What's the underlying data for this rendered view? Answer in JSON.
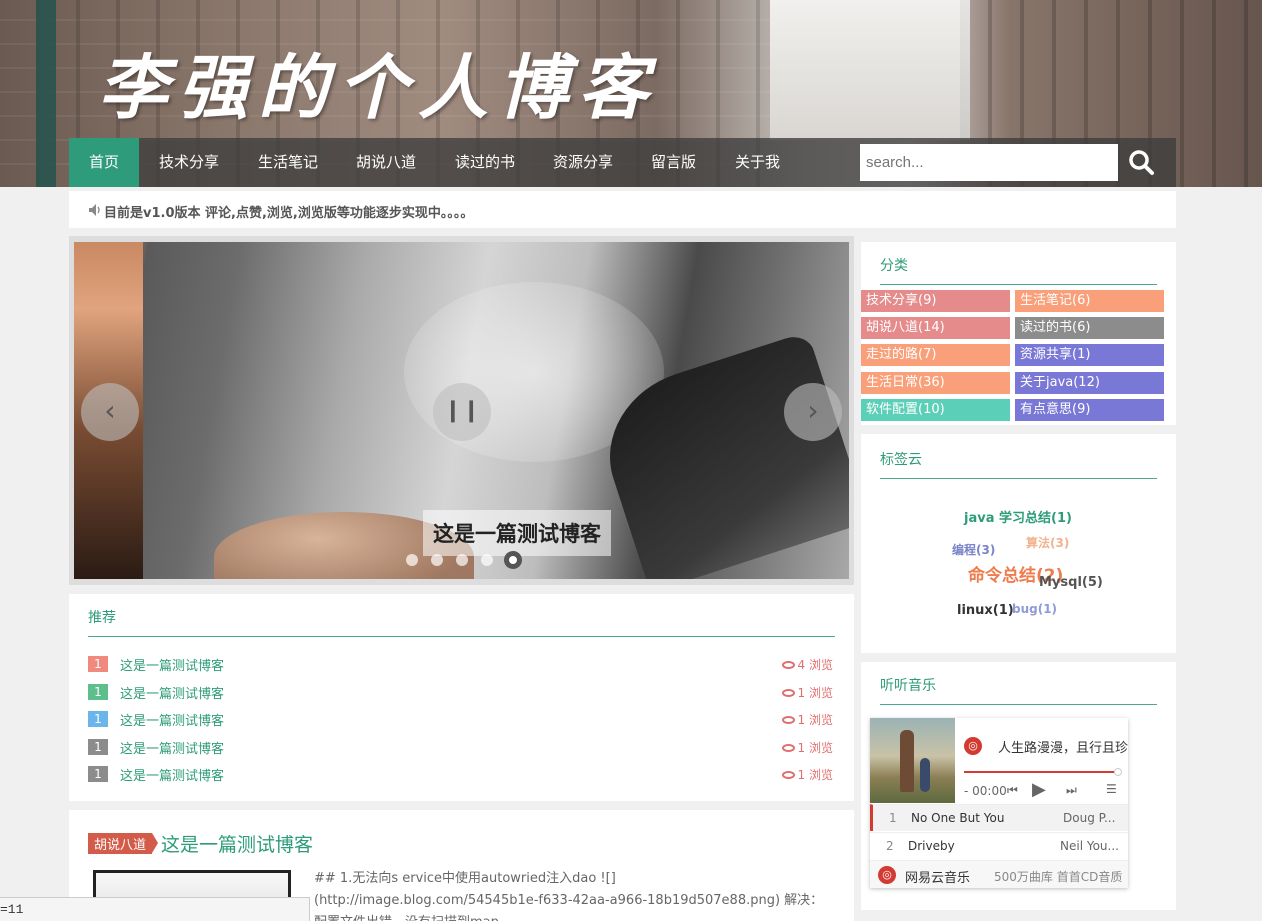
{
  "header": {
    "site_title": "李强的个人博客"
  },
  "nav": {
    "items": [
      "首页",
      "技术分享",
      "生活笔记",
      "胡说八道",
      "读过的书",
      "资源分享",
      "留言版",
      "关于我"
    ],
    "active_index": 0,
    "search_placeholder": "search..."
  },
  "notice": {
    "text": "目前是v1.0版本 评论,点赞,浏览,浏览版等功能逐步实现中。。。。"
  },
  "slider": {
    "caption": "这是一篇测试博客",
    "dot_count": 5,
    "active_dot": 4
  },
  "recommend": {
    "title": "推荐",
    "items": [
      {
        "rank": "1",
        "title": "这是一篇测试博客",
        "views": "4 浏览",
        "color": "#f18a7e"
      },
      {
        "rank": "1",
        "title": "这是一篇测试博客",
        "views": "1 浏览",
        "color": "#5fbf8c"
      },
      {
        "rank": "1",
        "title": "这是一篇测试博客",
        "views": "1 浏览",
        "color": "#6ab6ea"
      },
      {
        "rank": "1",
        "title": "这是一篇测试博客",
        "views": "1 浏览",
        "color": "#8c8c8c"
      },
      {
        "rank": "1",
        "title": "这是一篇测试博客",
        "views": "1 浏览",
        "color": "#8c8c8c"
      }
    ]
  },
  "article": {
    "category": "胡说八道",
    "title": "这是一篇测试博客",
    "excerpt": "## 1.无法向s ervice中使用autowried注入dao ![](http://image.blog.com/54545b1e-f633-42aa-a966-18b19d507e88.png) 解决：配置文件出错，没有扫描到map..."
  },
  "categories": {
    "title": "分类",
    "items": [
      {
        "label": "技术分享(9)",
        "color": "#e58b8b"
      },
      {
        "label": "生活笔记(6)",
        "color": "#f9a07a"
      },
      {
        "label": "胡说八道(14)",
        "color": "#e58b8b"
      },
      {
        "label": "读过的书(6)",
        "color": "#8c8c8c"
      },
      {
        "label": "走过的路(7)",
        "color": "#f9a07a"
      },
      {
        "label": "资源共享(1)",
        "color": "#7a78d6"
      },
      {
        "label": "生活日常(36)",
        "color": "#f9a07a"
      },
      {
        "label": "关于java(12)",
        "color": "#7a78d6"
      },
      {
        "label": "软件配置(10)",
        "color": "#5ccfb8"
      },
      {
        "label": "有点意思(9)",
        "color": "#7a78d6"
      }
    ]
  },
  "tag_cloud": {
    "title": "标签云",
    "tags": [
      {
        "label": "java 学习总结(1)",
        "color": "#2e9c7a"
      },
      {
        "label": "编程(3)",
        "color": "#7a84c9"
      },
      {
        "label": "算法(3)",
        "color": "#f2b38f"
      },
      {
        "label": "命令总结(2)",
        "color": "#ee7c4c"
      },
      {
        "label": "Mysql(5)",
        "color": "#555555"
      },
      {
        "label": "linux(1)",
        "color": "#333333"
      },
      {
        "label": "bug(1)",
        "color": "#8f9ad6"
      }
    ]
  },
  "music": {
    "title": "听听音乐",
    "now_playing": "人生路漫漫，且行且珍惜",
    "time": "- 00:00",
    "tracks": [
      {
        "no": "1",
        "name": "No One But You",
        "artist": "Doug P..."
      },
      {
        "no": "2",
        "name": "Driveby",
        "artist": "Neil You..."
      }
    ],
    "brand": "网易云音乐",
    "library": "500万曲库 首首CD音质"
  },
  "statusbar": {
    "text": "=11"
  }
}
